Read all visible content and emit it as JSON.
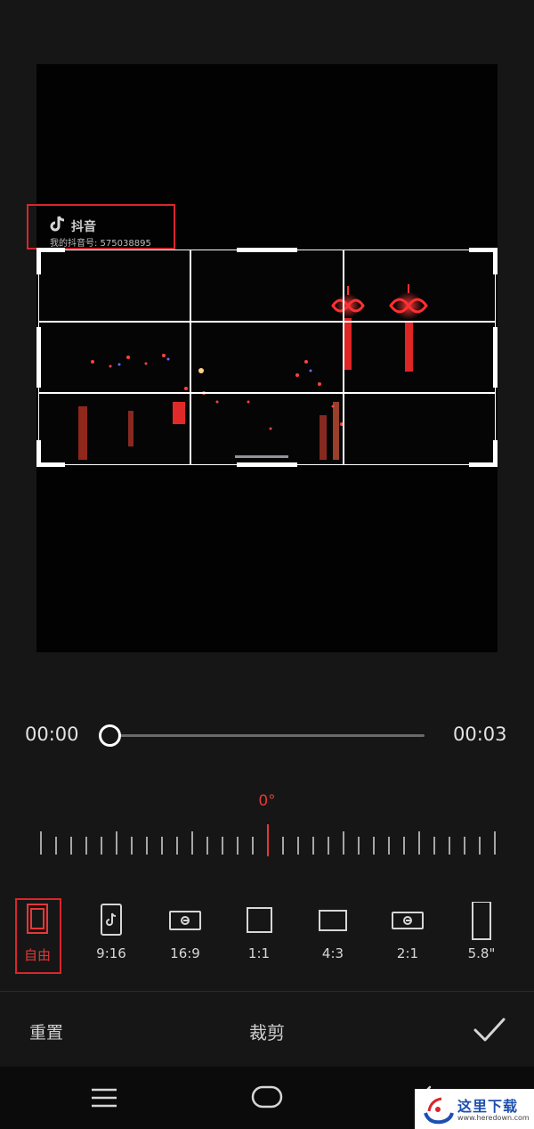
{
  "preview": {
    "watermark_app": "抖音",
    "watermark_id": "我的抖音号: 575038895"
  },
  "timeline": {
    "start_time": "00:00",
    "end_time": "00:03",
    "progress": 0
  },
  "rotation": {
    "angle_label": "0°"
  },
  "ratios": [
    {
      "label": "自由",
      "icon": "free-crop-icon",
      "selected": true
    },
    {
      "label": "9:16",
      "icon": "tiktok-portrait-icon",
      "selected": false
    },
    {
      "label": "16:9",
      "icon": "widescreen-icon",
      "selected": false
    },
    {
      "label": "1:1",
      "icon": "square-icon",
      "selected": false
    },
    {
      "label": "4:3",
      "icon": "four-three-icon",
      "selected": false
    },
    {
      "label": "2:1",
      "icon": "two-one-icon",
      "selected": false
    },
    {
      "label": "5.8\"",
      "icon": "phone-portrait-icon",
      "selected": false
    }
  ],
  "actions": {
    "reset_label": "重置",
    "title": "裁剪"
  },
  "site_logo": {
    "text": "这里下载",
    "url": "www.heredown.com"
  },
  "colors": {
    "accent": "#e53838",
    "highlight_box": "#d8262c",
    "background": "#161616"
  }
}
